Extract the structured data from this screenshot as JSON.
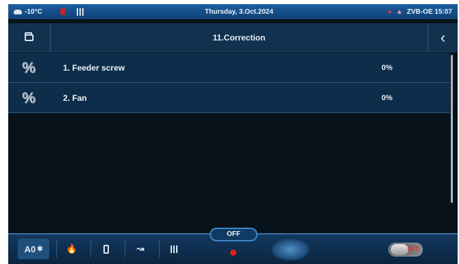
{
  "status": {
    "temperature": "-10°C",
    "datetime": "Thursday, 3.Oct.2024",
    "device_clock": "ZVB-OE 15:07",
    "icons": [
      "cloud-icon",
      "heating-icon",
      "radiator-icon",
      "alarm-icon",
      "warning-icon"
    ]
  },
  "header": {
    "title": "11.Correction",
    "back_glyph": "‹"
  },
  "list": {
    "items": [
      {
        "index": "1.",
        "label": "Feeder screw",
        "value": "0%"
      },
      {
        "index": "2.",
        "label": "Fan",
        "value": "0%"
      }
    ]
  },
  "toolbar": {
    "mode_label": "A0",
    "off_label": "OFF",
    "toggle_state": "OFF",
    "colors": {
      "record": "#e0201f",
      "toggle_state": "#e23030"
    }
  }
}
